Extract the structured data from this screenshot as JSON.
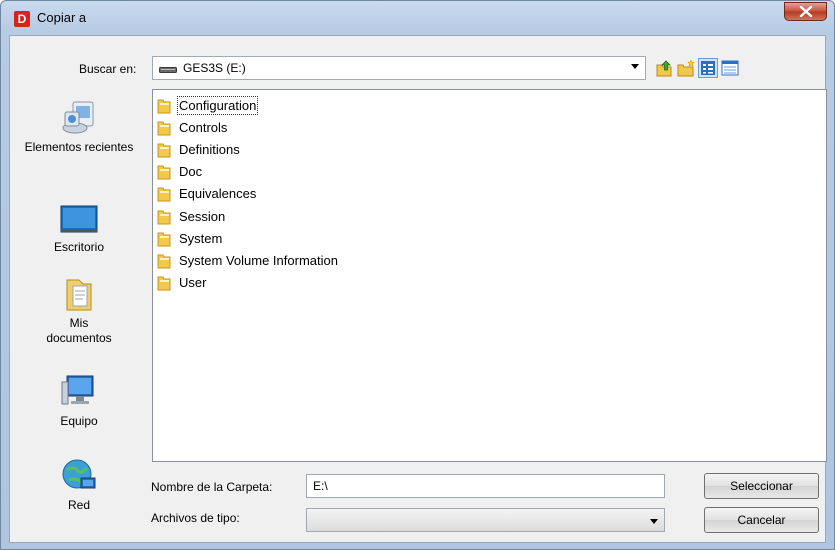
{
  "window": {
    "title": "Copiar a",
    "app_icon_letter": "D"
  },
  "lookin": {
    "label": "Buscar en:",
    "value": "GES3S (E:)"
  },
  "toolbar": {
    "icons": [
      "up-folder-icon",
      "new-folder-icon",
      "list-view-icon",
      "details-view-icon"
    ]
  },
  "places": [
    {
      "label": "Elementos recientes",
      "icon": "recent-items-icon"
    },
    {
      "label": "Escritorio",
      "icon": "desktop-icon"
    },
    {
      "label": "Mis documentos",
      "icon": "documents-icon"
    },
    {
      "label": "Equipo",
      "icon": "computer-icon"
    },
    {
      "label": "Red",
      "icon": "network-icon"
    }
  ],
  "files": [
    "Configuration",
    "Controls",
    "Definitions",
    "Doc",
    "Equivalences",
    "Session",
    "System",
    "System Volume Information",
    "User"
  ],
  "selected_file": "Configuration",
  "folder_name": {
    "label": "Nombre de la Carpeta:",
    "value": "E:\\"
  },
  "file_type": {
    "label": "Archivos de tipo:",
    "value": ""
  },
  "buttons": {
    "select": "Seleccionar",
    "cancel": "Cancelar"
  }
}
